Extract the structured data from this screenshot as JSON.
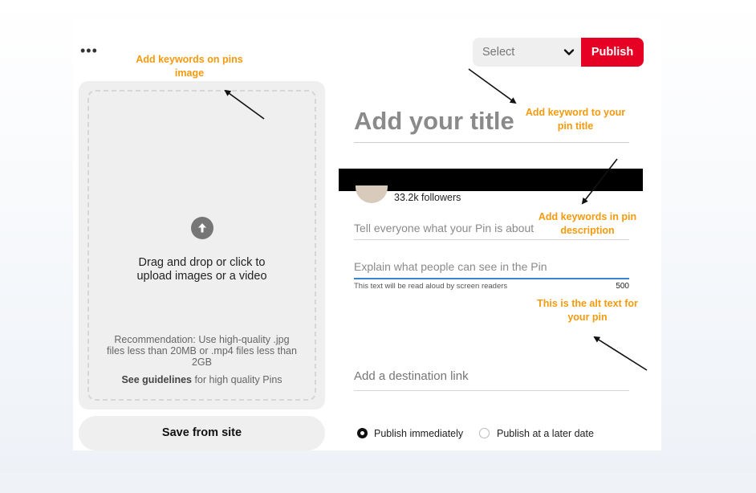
{
  "toolbar": {
    "more_label": "•••",
    "select_placeholder": "Select",
    "publish_label": "Publish"
  },
  "upload": {
    "drop_text_line1": "Drag and drop or click to",
    "drop_text_line2": "upload images or a video",
    "recommendation": "Recommendation: Use high-quality .jpg files less than 20MB or .mp4 files less than 2GB",
    "guidelines_link": "See guidelines",
    "guidelines_rest": " for high quality Pins",
    "save_from_site": "Save from site",
    "icon": "upload-arrow-icon"
  },
  "form": {
    "title_placeholder": "Add your title",
    "followers": "33.2k followers",
    "description_placeholder": "Tell everyone what your Pin is about",
    "alt_placeholder": "Explain what people can see in the Pin",
    "alt_hint": "This text will be read aloud by screen readers",
    "alt_count": "500",
    "link_placeholder": "Add a destination link",
    "publish_immediately": "Publish immediately",
    "publish_later": "Publish at a later date",
    "publish_mode_selected": "Publish immediately"
  },
  "annotations": {
    "image": "Add keywords on pins image",
    "title": "Add keyword to your pin title",
    "description": "Add keywords in pin description",
    "alt": "This is the alt text for your pin"
  },
  "colors": {
    "accent": "#e60023",
    "annotation": "#f59a0c",
    "focus": "#3b82d6"
  }
}
